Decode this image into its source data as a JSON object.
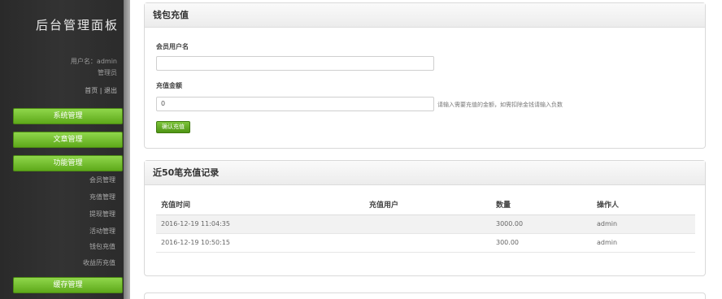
{
  "sidebar": {
    "brand": "后台管理面板",
    "user_line": "用户名：admin",
    "role": "管理员",
    "home": "首页",
    "separator": " | ",
    "logout": "退出",
    "menu": [
      {
        "label": "系统管理"
      },
      {
        "label": "文章管理"
      },
      {
        "label": "功能管理"
      }
    ],
    "submenu": [
      "会员管理",
      "充值管理",
      "提现管理",
      "活动管理",
      "钱包充值",
      "收益历充值"
    ],
    "bottom_button": "缓存管理"
  },
  "recharge": {
    "title": "钱包充值",
    "username_label": "会员用户名",
    "username_value": "",
    "amount_label": "充值金额",
    "amount_value": "0",
    "hint": "请输入需要充值的金额，如需扣除金钱请输入负数",
    "submit": "确认充值"
  },
  "records": {
    "title": "近50笔充值记录",
    "columns": [
      "充值时间",
      "充值用户",
      "数量",
      "操作人"
    ],
    "rows": [
      [
        "2016-12-19 11:04:35",
        "",
        "3000.00",
        "admin"
      ],
      [
        "2016-12-19 10:50:15",
        "",
        "300.00",
        "admin"
      ]
    ]
  },
  "colors": {
    "accent_green": "#6cbf22",
    "sidebar_dark": "#2e2e2e"
  }
}
